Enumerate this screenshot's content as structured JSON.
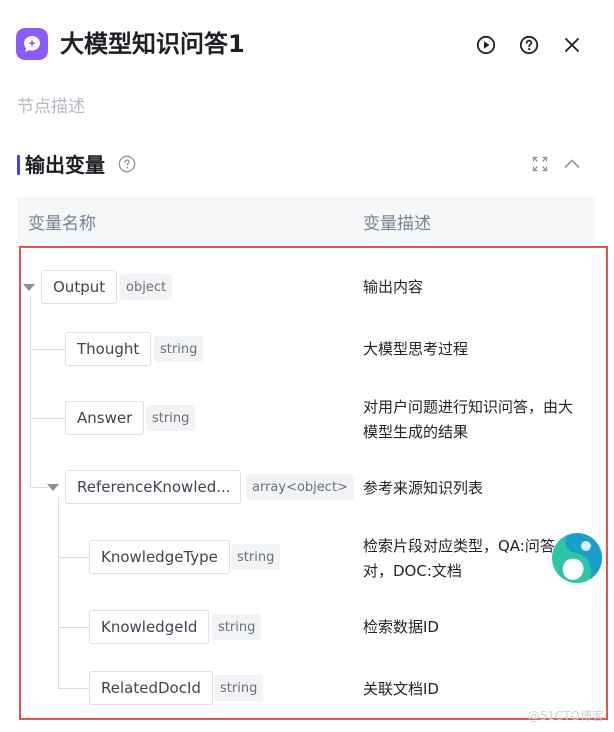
{
  "header": {
    "title": "大模型知识问答1",
    "description_placeholder": "节点描述",
    "icons": [
      "chat-bubble-icon",
      "play-icon",
      "help-icon",
      "close-icon"
    ]
  },
  "section": {
    "title": "输出变量",
    "icons": [
      "help-icon",
      "fullscreen-icon",
      "chevron-up-icon"
    ]
  },
  "table": {
    "col_name": "变量名称",
    "col_desc": "变量描述"
  },
  "variables": [
    {
      "name": "Output",
      "type": "object",
      "desc": "输出内容"
    },
    {
      "name": "Thought",
      "type": "string",
      "desc": "大模型思考过程"
    },
    {
      "name": "Answer",
      "type": "string",
      "desc_line1": "对用户问题进行知识问答，由大",
      "desc_line2": "模型生成的结果"
    },
    {
      "name": "ReferenceKnowled...",
      "type": "array<object>",
      "desc": "参考来源知识列表"
    },
    {
      "name": "KnowledgeType",
      "type": "string",
      "desc_line1": "检索片段对应类型，QA:问答",
      "desc_line2": "对，DOC:文档"
    },
    {
      "name": "KnowledgeId",
      "type": "string",
      "desc": "检索数据ID"
    },
    {
      "name": "RelatedDocId",
      "type": "string",
      "desc": "关联文档ID"
    }
  ],
  "watermark": "@51CTO博客",
  "colors": {
    "accent": "#8b5cf6",
    "section_bar": "#4e40e5",
    "highlight_border": "#e5534b"
  }
}
